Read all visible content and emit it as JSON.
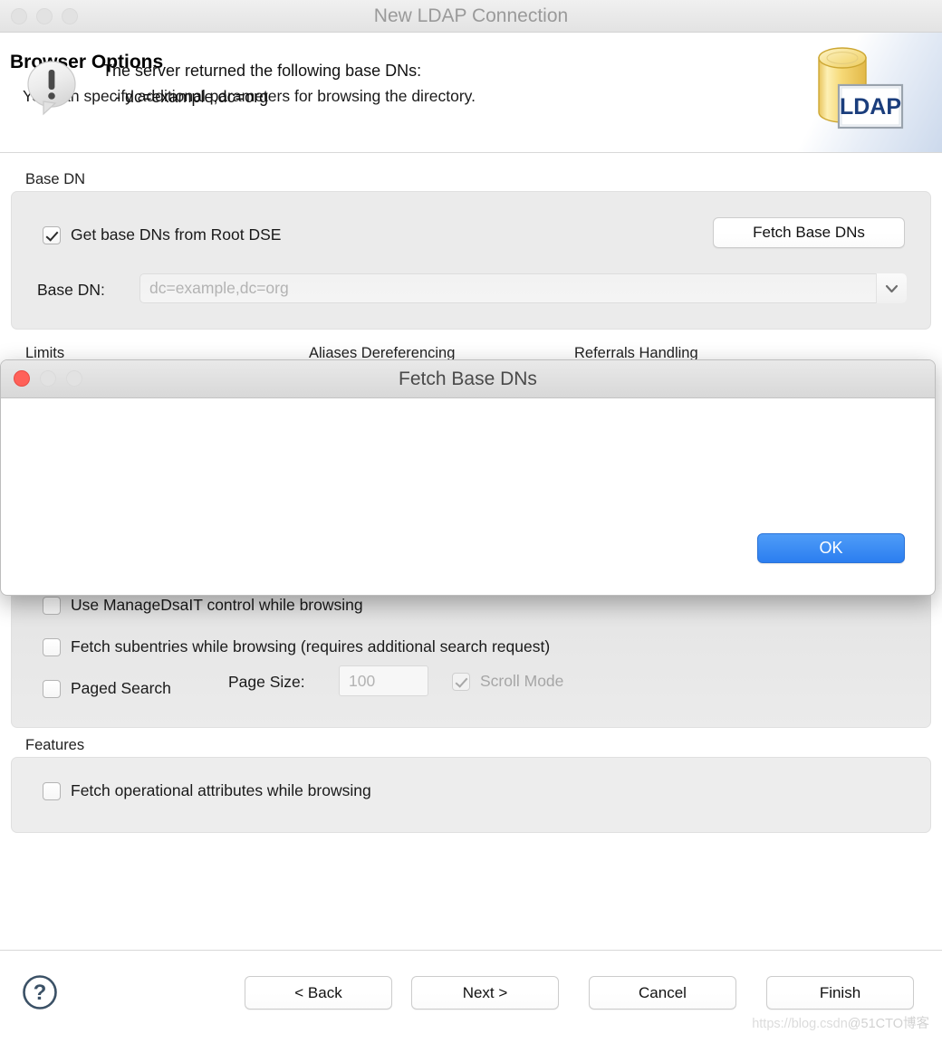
{
  "window": {
    "title": "New LDAP Connection",
    "traffic_lights": [
      "close",
      "minimize",
      "zoom"
    ]
  },
  "wizard": {
    "heading": "Browser Options",
    "description": "You can specify additional parameters for browsing the directory.",
    "banner_icon_label": "LDAP"
  },
  "base_dn_group": {
    "label": "Base DN",
    "get_base_dns_checkbox": {
      "label": "Get base DNs from Root DSE",
      "checked": true
    },
    "fetch_button": "Fetch Base DNs",
    "base_dn_field": {
      "label": "Base DN:",
      "value": "",
      "placeholder": "dc=example,dc=org"
    }
  },
  "hidden_groups": [
    {
      "label": "Limits"
    },
    {
      "label": "Aliases Dereferencing"
    },
    {
      "label": "Referrals Handling"
    }
  ],
  "controls_group": {
    "manage_dsait": {
      "label": "Use ManageDsaIT control while browsing",
      "checked": false
    },
    "fetch_subentries": {
      "label": "Fetch subentries while browsing (requires additional search request)",
      "checked": false
    },
    "paged_search": {
      "label": "Paged Search",
      "checked": false
    },
    "page_size_label": "Page Size:",
    "page_size_value": "",
    "page_size_placeholder": "100",
    "scroll_mode": {
      "label": "Scroll Mode",
      "checked": true,
      "disabled": true
    }
  },
  "features_group": {
    "label": "Features",
    "fetch_operational": {
      "label": "Fetch operational attributes while browsing",
      "checked": false
    }
  },
  "footer": {
    "help_icon": "question-mark-icon",
    "back": "< Back",
    "next": "Next >",
    "cancel": "Cancel",
    "finish": "Finish",
    "watermark": "https://blog.csdn",
    "watermark_cn": "@51CTO博客"
  },
  "dialog": {
    "title": "Fetch Base DNs",
    "icon": "alert-bubble-icon",
    "message_line1": "The server returned the following base DNs:",
    "message_line2": "- dc=example,dc=org",
    "ok_label": "OK"
  },
  "colors": {
    "accent_blue": "#2b7ef0",
    "close_red": "#ff6159",
    "group_bg": "#ebebeb",
    "title_gray": "#9a9a9a"
  }
}
